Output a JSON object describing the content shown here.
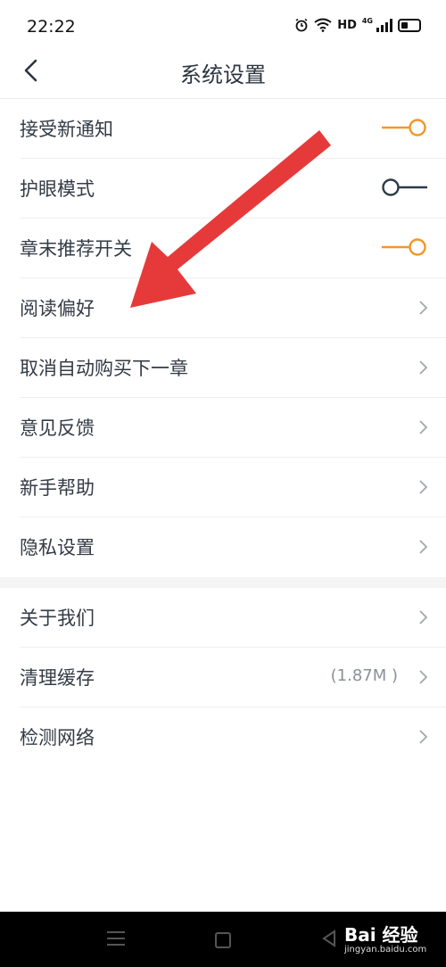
{
  "status_bar": {
    "time": "22:22",
    "hd": "HD",
    "network": "4G"
  },
  "header": {
    "title": "系统设置"
  },
  "colors": {
    "accent": "#f0982a",
    "toggle_off": "#2f3b48",
    "arrow": "#e63a3a"
  },
  "settings": {
    "toggles": [
      {
        "label": "接受新通知",
        "on": true
      },
      {
        "label": "护眼模式",
        "on": false
      },
      {
        "label": "章末推荐开关",
        "on": true
      }
    ],
    "links": [
      {
        "label": "阅读偏好"
      },
      {
        "label": "取消自动购买下一章"
      },
      {
        "label": "意见反馈"
      },
      {
        "label": "新手帮助"
      },
      {
        "label": "隐私设置"
      }
    ]
  },
  "more": {
    "about": {
      "label": "关于我们"
    },
    "clear_cache": {
      "label": "清理缓存",
      "value": "(1.87M )"
    },
    "network_check": {
      "label": "检测网络"
    }
  },
  "watermark": {
    "brand": "Bai 经验",
    "url": "jingyan.baidu.com"
  }
}
